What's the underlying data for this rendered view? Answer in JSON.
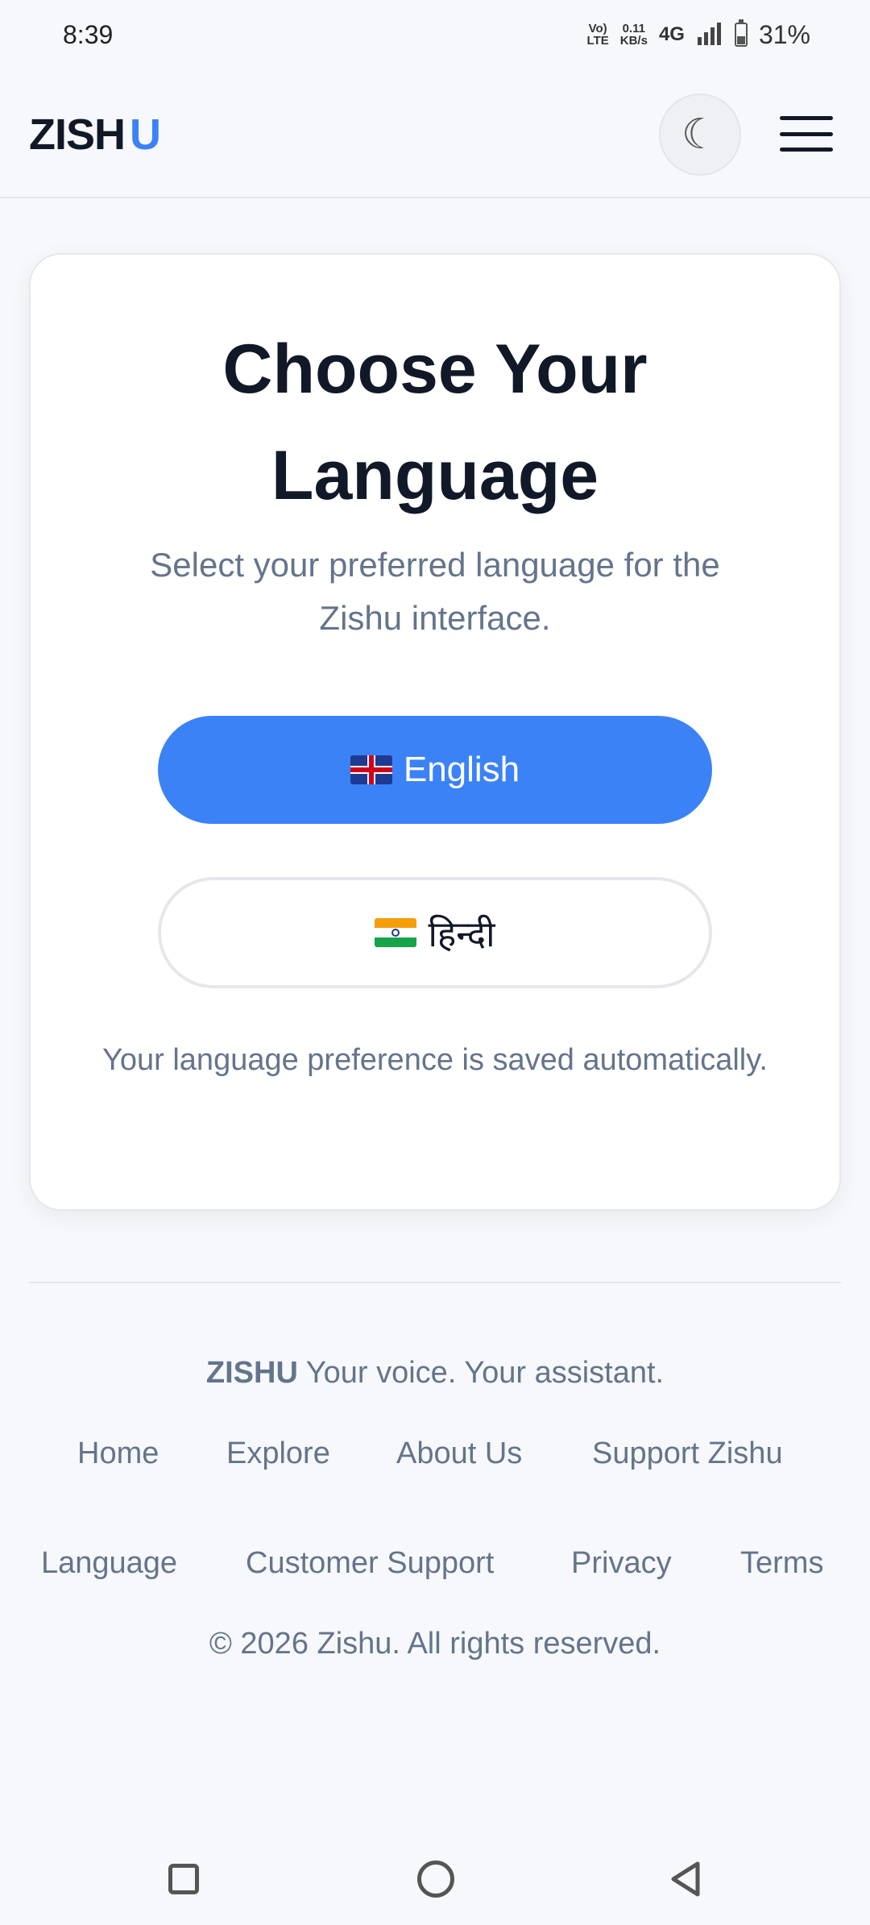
{
  "status_bar": {
    "time": "8:39",
    "volte_top": "Vo)",
    "volte_bottom": "LTE",
    "speed_top": "0.11",
    "speed_bottom": "KB/s",
    "network": "4G",
    "battery_percent": "31%"
  },
  "header": {
    "logo_main": "ZISH",
    "logo_accent": "U",
    "theme_icon": "moon-icon",
    "menu_icon": "hamburger-icon"
  },
  "card": {
    "title": "Choose Your Language",
    "subtitle": "Select your preferred language for the Zishu interface.",
    "english_label": "English",
    "hindi_label": "हिन्दी",
    "note": "Your language preference is saved automatically."
  },
  "footer": {
    "brand": "ZISHU",
    "tagline": "Your voice. Your assistant.",
    "links_row1": [
      "Home",
      "Explore",
      "About Us",
      "Support Zishu"
    ],
    "links_row2": [
      "Language",
      "Customer Support",
      "Privacy",
      "Terms"
    ],
    "copyright": "© 2026 Zishu. All rights reserved."
  },
  "colors": {
    "accent": "#3b82f6",
    "background": "#f7f8fb",
    "text_dark": "#111827",
    "text_muted": "#64748b"
  }
}
